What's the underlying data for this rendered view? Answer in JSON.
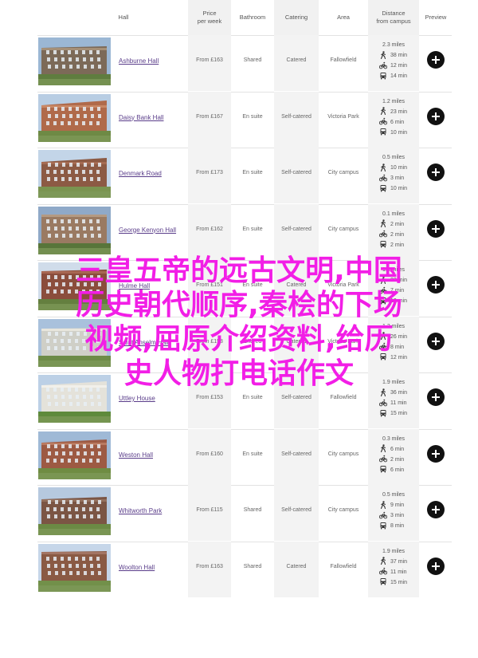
{
  "header": {
    "hall": "Hall",
    "price_line1": "Price",
    "price_line2": "per week",
    "bathroom": "Bathroom",
    "catering": "Catering",
    "area": "Area",
    "distance_line1": "Distance",
    "distance_line2": "from campus",
    "preview": "Preview"
  },
  "rows": [
    {
      "name": "Ashburne Hall",
      "price": "From £163",
      "bathroom": "Shared",
      "catering": "Catered",
      "area": "Fallowfield",
      "miles": "2.3 miles",
      "walk": "38 min",
      "bike": "12 min",
      "bus": "14 min"
    },
    {
      "name": "Daisy Bank Hall",
      "price": "From £167",
      "bathroom": "En suite",
      "catering": "Self-catered",
      "area": "Victoria Park",
      "miles": "1.2 miles",
      "walk": "23 min",
      "bike": "6 min",
      "bus": "10 min"
    },
    {
      "name": "Denmark Road",
      "price": "From £173",
      "bathroom": "En suite",
      "catering": "Self-catered",
      "area": "City campus",
      "miles": "0.5 miles",
      "walk": "10 min",
      "bike": "3 min",
      "bus": "10 min"
    },
    {
      "name": "George Kenyon Hall",
      "price": "From £162",
      "bathroom": "En suite",
      "catering": "Self-catered",
      "area": "City campus",
      "miles": "0.1 miles",
      "walk": "2 min",
      "bike": "2 min",
      "bus": "2 min"
    },
    {
      "name": "Hulme Hall",
      "price": "From £151",
      "bathroom": "En suite",
      "catering": "Catered",
      "area": "Victoria Park",
      "miles": "1.1 miles",
      "walk": "22 min",
      "bike": "7 min",
      "bus": "12 min"
    },
    {
      "name": "Saint Anselm Hall",
      "price": "From £158",
      "bathroom": "Shared",
      "catering": "Catered",
      "area": "Victoria Park",
      "miles": "1.3 miles",
      "walk": "26 min",
      "bike": "8 min",
      "bus": "12 min"
    },
    {
      "name": "Uttley House",
      "price": "From £153",
      "bathroom": "En suite",
      "catering": "Self-catered",
      "area": "Fallowfield",
      "miles": "1.9 miles",
      "walk": "36 min",
      "bike": "11 min",
      "bus": "15 min"
    },
    {
      "name": "Weston Hall",
      "price": "From £160",
      "bathroom": "En suite",
      "catering": "Self-catered",
      "area": "City campus",
      "miles": "0.3 miles",
      "walk": "6 min",
      "bike": "2 min",
      "bus": "6 min"
    },
    {
      "name": "Whitworth Park",
      "price": "From £115",
      "bathroom": "Shared",
      "catering": "Self-catered",
      "area": "City campus",
      "miles": "0.5 miles",
      "walk": "9 min",
      "bike": "3 min",
      "bus": "8 min"
    },
    {
      "name": "Woolton Hall",
      "price": "From £163",
      "bathroom": "Shared",
      "catering": "Catered",
      "area": "Fallowfield",
      "miles": "1.9 miles",
      "walk": "37 min",
      "bike": "11 min",
      "bus": "15 min"
    }
  ],
  "overlay": {
    "line1": "三皇五帝的远古文明,中国",
    "line2": "历史朝代顺序,秦桧的下场",
    "line3": "视频,屈原介绍资料,给历",
    "line4": "史人物打电话作文"
  },
  "colors": {
    "link": "#5a3d8a",
    "overlay": "#f21ee6",
    "button": "#111111",
    "shade": "#f3f3f3"
  }
}
